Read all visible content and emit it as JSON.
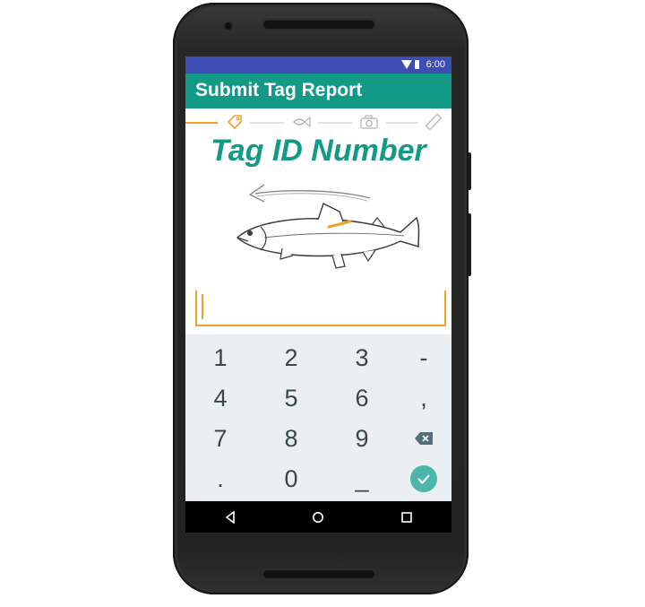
{
  "status_bar": {
    "time": "6:00",
    "icons": [
      "wifi-icon",
      "battery-icon"
    ]
  },
  "app_bar": {
    "title": "Submit Tag Report"
  },
  "progress_steps": {
    "items": [
      "tag-icon",
      "fish-icon",
      "camera-icon",
      "ruler-icon"
    ],
    "active_index": 0
  },
  "heading": "Tag ID Number",
  "tag_input": {
    "value": ""
  },
  "keypad": {
    "rows": [
      [
        "1",
        "2",
        "3",
        "-"
      ],
      [
        "4",
        "5",
        "6",
        ","
      ],
      [
        "7",
        "8",
        "9",
        "backspace-icon"
      ],
      [
        ".",
        "0",
        "_",
        "check-icon"
      ]
    ]
  },
  "nav_bar": {
    "icons": [
      "back-icon",
      "home-icon",
      "recents-icon"
    ]
  },
  "colors": {
    "status_bar": "#3e4db4",
    "app_bar": "#129a87",
    "accent": "#f2a02b",
    "heading": "#129a87",
    "keyboard_bg": "#eceff1",
    "key_text": "#37474f",
    "confirm_button": "#4db6ac"
  }
}
